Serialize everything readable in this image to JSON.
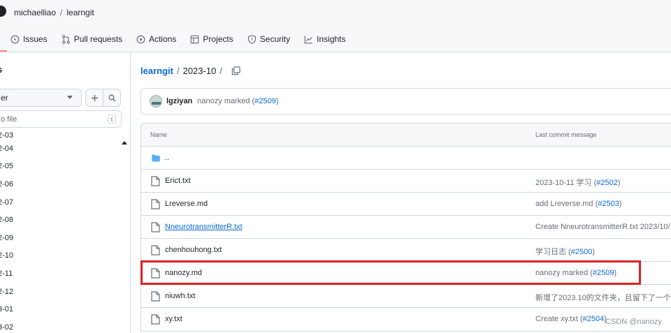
{
  "header": {
    "owner": "michaelliao",
    "separator": "/",
    "repo": "learngit"
  },
  "nav": {
    "items": [
      {
        "label": "Issues",
        "icon": "issue-icon"
      },
      {
        "label": "Pull requests",
        "icon": "pull-request-icon"
      },
      {
        "label": "Actions",
        "icon": "play-icon"
      },
      {
        "label": "Projects",
        "icon": "table-icon"
      },
      {
        "label": "Security",
        "icon": "shield-icon"
      },
      {
        "label": "Insights",
        "icon": "graph-icon"
      }
    ]
  },
  "sidebar": {
    "title": "s",
    "branch_label": "er",
    "goto_placeholder": "o file",
    "goto_shortcut": "t",
    "items": [
      "2-03",
      "2-04",
      "2-05",
      "2-06",
      "2-07",
      "2-08",
      "2-09",
      "2-10",
      "2-11",
      "2-12",
      "3-01",
      "3-02"
    ]
  },
  "path": {
    "repo": "learngit",
    "dir": "2023-10",
    "sep": "/"
  },
  "commit": {
    "author": "lgziyan",
    "message": "nanozy marked (",
    "ref": "#2509",
    "close": ")"
  },
  "table": {
    "col_name": "Name",
    "col_msg": "Last commit message",
    "rows": [
      {
        "name": "..",
        "type": "folder",
        "msg": "",
        "ref": "",
        "close": ""
      },
      {
        "name": "Erict.txt",
        "type": "file",
        "msg": "2023-10-11 学习 (",
        "ref": "#2502",
        "close": ")"
      },
      {
        "name": "Lreverse.md",
        "type": "file",
        "msg": "add Lreverse.md (",
        "ref": "#2503",
        "close": ")"
      },
      {
        "name": "NneurotransmitterR.txt",
        "type": "file",
        "msg": "Create NneurotransmitterR.txt 2023/10/",
        "ref": "",
        "close": ""
      },
      {
        "name": "chenhouhong.txt",
        "type": "file",
        "msg": "学习日志 (",
        "ref": "#2500",
        "close": ")"
      },
      {
        "name": "nanozy.md",
        "type": "file",
        "msg": "nanozy marked (",
        "ref": "#2509",
        "close": ")"
      },
      {
        "name": "niuwh.txt",
        "type": "file",
        "msg": "新增了2023.10的文件夹，且留下了一个",
        "ref": "",
        "close": ""
      },
      {
        "name": "xy.txt",
        "type": "file",
        "msg": "Create xy.txt (",
        "ref": "#2504",
        "close": ")"
      }
    ]
  },
  "watermark": "CSDN @nanozy",
  "colors": {
    "link": "#0969da",
    "highlight": "#e02020",
    "folder": "#54aeff"
  }
}
